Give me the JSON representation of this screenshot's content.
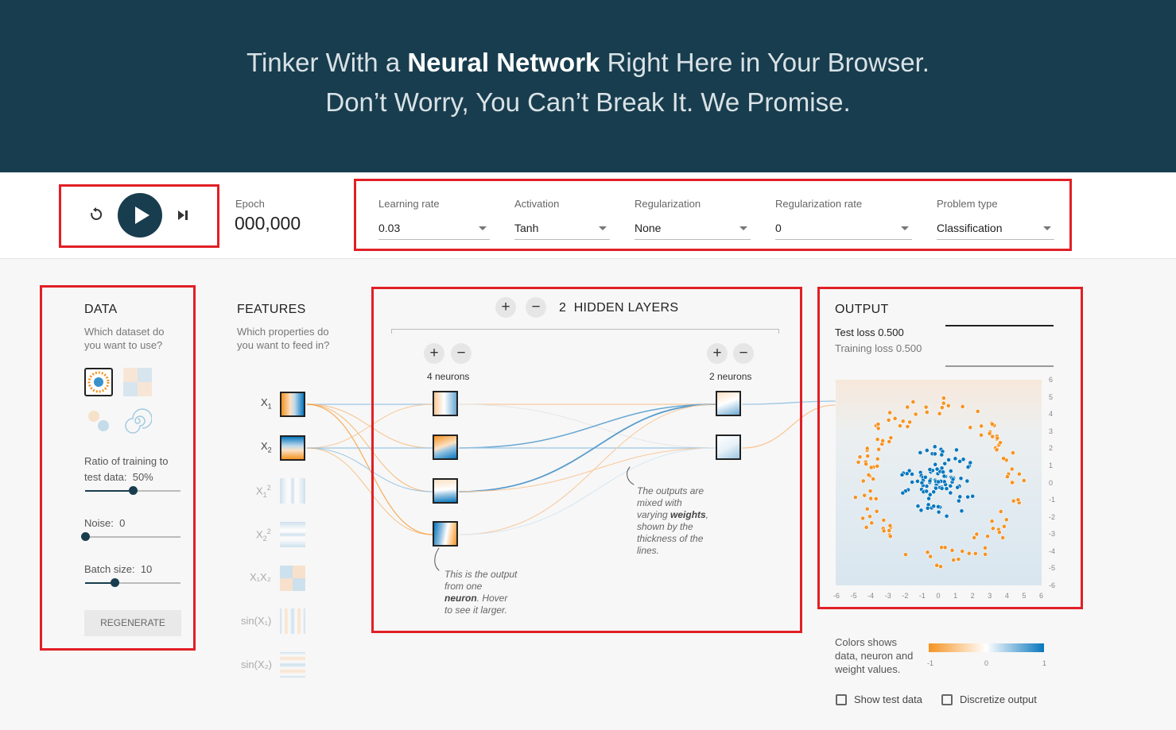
{
  "hero": {
    "line1_pre": "Tinker With a ",
    "line1_bold": "Neural Network",
    "line1_post": " Right Here in Your Browser.",
    "line2": "Don’t Worry, You Can’t Break It. We Promise."
  },
  "controls": {
    "epoch_label": "Epoch",
    "epoch_value": "000,000",
    "learning_rate": {
      "label": "Learning rate",
      "value": "0.03"
    },
    "activation": {
      "label": "Activation",
      "value": "Tanh"
    },
    "regularization": {
      "label": "Regularization",
      "value": "None"
    },
    "regularization_rate": {
      "label": "Regularization rate",
      "value": "0"
    },
    "problem_type": {
      "label": "Problem type",
      "value": "Classification"
    }
  },
  "data_panel": {
    "title": "DATA",
    "subtitle_1": "Which dataset do",
    "subtitle_2": "you want to use?",
    "ratio_label": "Ratio of training to",
    "ratio_label_2": "test data:",
    "ratio_value": "50%",
    "ratio_fraction": 0.5,
    "noise_label": "Noise:",
    "noise_value": "0",
    "noise_fraction": 0.0,
    "batch_label": "Batch size:",
    "batch_value": "10",
    "batch_fraction": 0.31,
    "regenerate": "REGENERATE"
  },
  "features_panel": {
    "title": "FEATURES",
    "subtitle_1": "Which properties do",
    "subtitle_2": "you want to feed in?",
    "features": [
      {
        "label": "X",
        "sub": "1",
        "sup": "",
        "active": true
      },
      {
        "label": "X",
        "sub": "2",
        "sup": "",
        "active": true
      },
      {
        "label": "X",
        "sub": "1",
        "sup": "2",
        "active": false
      },
      {
        "label": "X",
        "sub": "2",
        "sup": "2",
        "active": false
      },
      {
        "label": "X₁X₂",
        "sub": "",
        "sup": "",
        "active": false
      },
      {
        "label": "sin(X₁)",
        "sub": "",
        "sup": "",
        "active": false
      },
      {
        "label": "sin(X₂)",
        "sub": "",
        "sup": "",
        "active": false
      }
    ]
  },
  "network": {
    "hidden_layers_count": "2",
    "hidden_layers_label": "HIDDEN LAYERS",
    "layer1_neurons": "4 neurons",
    "layer2_neurons": "2 neurons",
    "note1_line1": "This is the output",
    "note1_line2": "from one",
    "note1_bold": "neuron",
    "note1_line3": ". Hover",
    "note1_line4": "to see it larger.",
    "note2_line1": "The outputs are",
    "note2_line2": "mixed with",
    "note2_line3": "varying ",
    "note2_bold": "weights",
    "note2_line3b": ",",
    "note2_line4": "shown by the",
    "note2_line5": "thickness of the",
    "note2_line6": "lines."
  },
  "output_panel": {
    "title": "OUTPUT",
    "test_loss_label": "Test loss",
    "test_loss_value": "0.500",
    "train_loss_label": "Training loss",
    "train_loss_value": "0.500",
    "x_ticks": [
      "-6",
      "-5",
      "-4",
      "-3",
      "-2",
      "-1",
      "0",
      "1",
      "2",
      "3",
      "4",
      "5",
      "6"
    ],
    "y_ticks": [
      "6",
      "5",
      "4",
      "3",
      "2",
      "1",
      "0",
      "-1",
      "-2",
      "-3",
      "-4",
      "-5",
      "-6"
    ],
    "legend_text_1": "Colors shows",
    "legend_text_2": "data, neuron and",
    "legend_text_3": "weight values.",
    "legend_min": "-1",
    "legend_mid": "0",
    "legend_max": "1",
    "show_test_data": "Show test data",
    "discretize_output": "Discretize output"
  },
  "colors": {
    "header_bg": "#183d4e",
    "orange": "#f59322",
    "blue": "#0877bd",
    "highlight": "#e11f26"
  }
}
